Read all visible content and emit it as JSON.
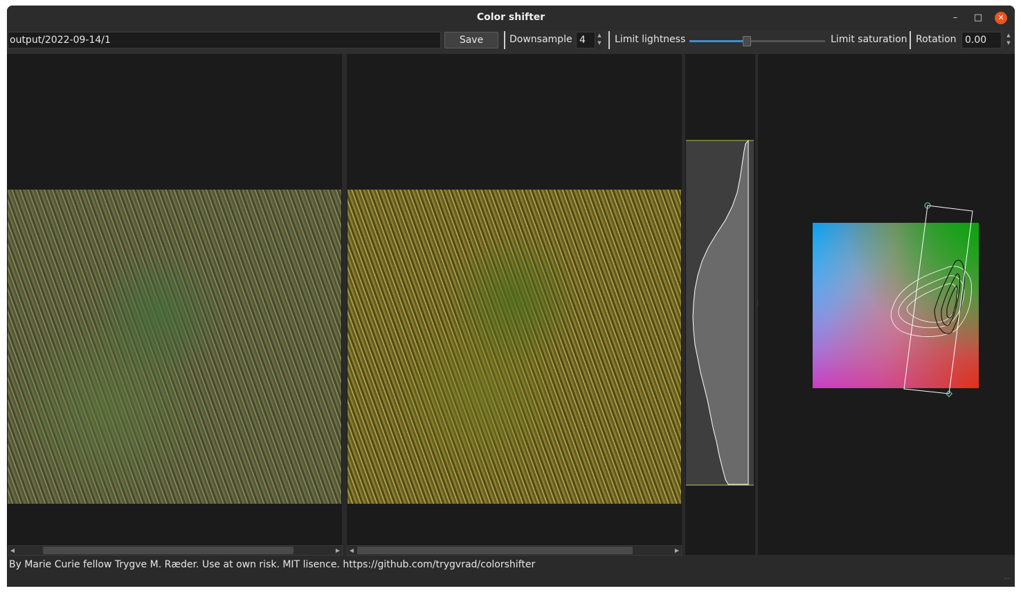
{
  "window": {
    "title": "Color shifter"
  },
  "toolbar": {
    "path_value": "output/2022-09-14/1",
    "save_label": "Save",
    "downsample_label": "Downsample",
    "downsample_value": "4",
    "limit_lightness_label": "Limit lightness",
    "lightness_slider_fraction": 0.42,
    "limit_saturation_label": "Limit saturation",
    "rotation_label": "Rotation",
    "rotation_value": "0.00"
  },
  "icons": [
    "minimize-icon",
    "maximize-icon",
    "close-icon",
    "spin-up-icon",
    "spin-down-icon",
    "scroll-left-icon",
    "scroll-right-icon"
  ],
  "colors": {
    "accent": "#3d8fd6",
    "close_button": "#e95420",
    "background": "#2a2a2a",
    "pane": "#1b1b1b"
  },
  "status_bar": {
    "text": "By Marie Curie fellow Trygve M. Ræder. Use at own risk. MIT lisence. https://github.com/trygvrad/colorshifter"
  }
}
